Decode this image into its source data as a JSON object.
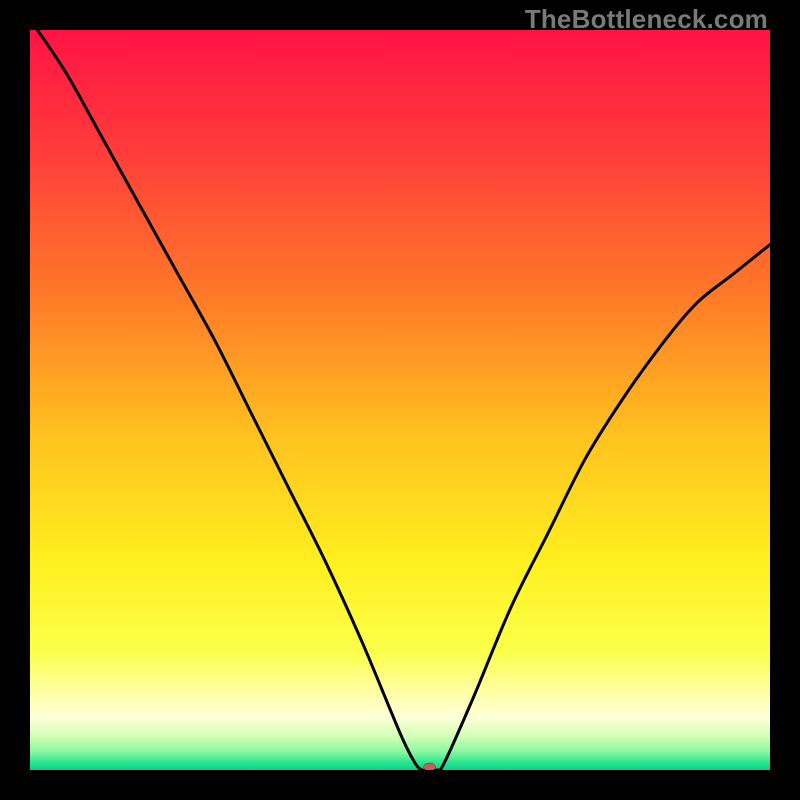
{
  "watermark": "TheBottleneck.com",
  "chart_data": {
    "type": "line",
    "title": "",
    "xlabel": "",
    "ylabel": "",
    "xlim": [
      0,
      100
    ],
    "ylim": [
      0,
      100
    ],
    "grid": false,
    "legend": "none",
    "curve": {
      "name": "bottleneck-curve",
      "x": [
        1,
        5,
        10,
        15,
        20,
        25,
        30,
        35,
        40,
        45,
        50,
        52,
        53,
        54,
        55,
        56,
        60,
        65,
        70,
        75,
        80,
        85,
        90,
        95,
        100
      ],
      "y": [
        100,
        94,
        85,
        76,
        67,
        58,
        48,
        38,
        28,
        17,
        5,
        1,
        0,
        0,
        0,
        1,
        10,
        22,
        32,
        42,
        50,
        57,
        63,
        67,
        71
      ]
    },
    "marker": {
      "x": 54,
      "y": 0,
      "color": "#c75c55",
      "rx": 6,
      "ry": 4
    },
    "background": {
      "type": "vertical-gradient",
      "stops": [
        {
          "offset": 0.0,
          "color": "#ff1344"
        },
        {
          "offset": 0.16,
          "color": "#ff3b3b"
        },
        {
          "offset": 0.36,
          "color": "#ff7a28"
        },
        {
          "offset": 0.55,
          "color": "#ffc21f"
        },
        {
          "offset": 0.72,
          "color": "#fff01f"
        },
        {
          "offset": 0.84,
          "color": "#fbff4a"
        },
        {
          "offset": 0.907,
          "color": "#ffffb8"
        },
        {
          "offset": 0.93,
          "color": "#fdffd8"
        },
        {
          "offset": 0.955,
          "color": "#d0ffb6"
        },
        {
          "offset": 0.975,
          "color": "#8cf7a2"
        },
        {
          "offset": 0.99,
          "color": "#2be58f"
        },
        {
          "offset": 1.0,
          "color": "#05d38c"
        }
      ]
    }
  }
}
